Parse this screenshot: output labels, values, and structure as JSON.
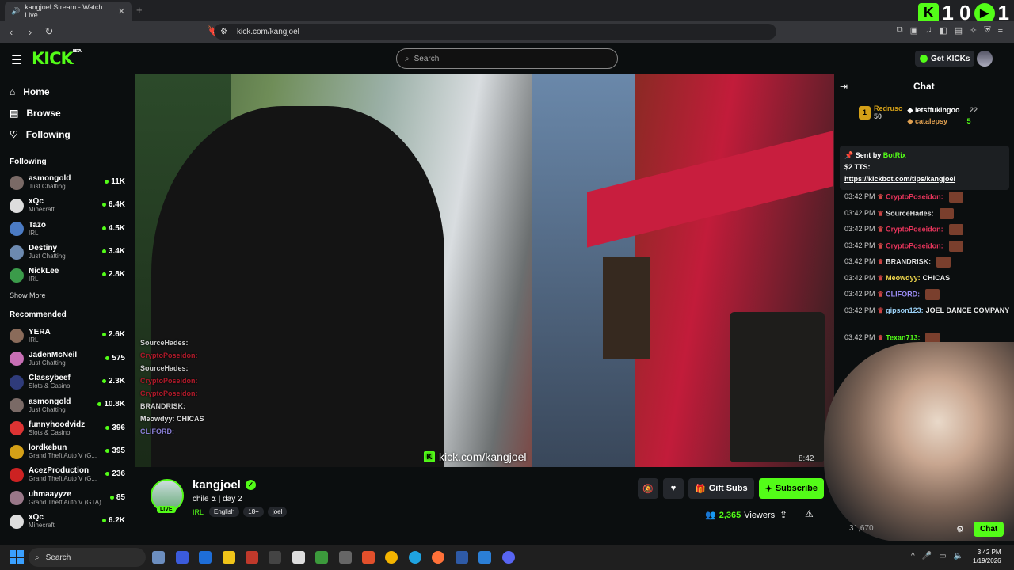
{
  "browser": {
    "tab_title": "kangjoel Stream - Watch Live",
    "url": "kick.com/kangjoel",
    "overlay_counter_1": "1 0",
    "overlay_counter_2": "1"
  },
  "header": {
    "logo": "KICK",
    "logo_badge": "BETA",
    "search_placeholder": "Search",
    "get_kicks": "Get KICKs"
  },
  "sidebar": {
    "nav": [
      {
        "icon": "home-icon",
        "label": "Home"
      },
      {
        "icon": "browse-icon",
        "label": "Browse"
      },
      {
        "icon": "heart-icon",
        "label": "Following"
      }
    ],
    "following_title": "Following",
    "following": [
      {
        "name": "asmongold",
        "category": "Just Chatting",
        "viewers": "11K",
        "color": "#7a6a66"
      },
      {
        "name": "xQc",
        "category": "Minecraft",
        "viewers": "6.4K",
        "color": "#dddddd"
      },
      {
        "name": "Tazo",
        "category": "IRL",
        "viewers": "4.5K",
        "color": "#4b7bc4"
      },
      {
        "name": "Destiny",
        "category": "Just Chatting",
        "viewers": "3.4K",
        "color": "#6d8ab0"
      },
      {
        "name": "NickLee",
        "category": "IRL",
        "viewers": "2.8K",
        "color": "#3b9b4a"
      }
    ],
    "show_more": "Show More",
    "recommended_title": "Recommended",
    "recommended": [
      {
        "name": "YERA",
        "category": "IRL",
        "viewers": "2.6K",
        "color": "#8a6b5a"
      },
      {
        "name": "JadenMcNeil",
        "category": "Just Chatting",
        "viewers": "575",
        "color": "#c86fb5"
      },
      {
        "name": "Classybeef",
        "category": "Slots & Casino",
        "viewers": "2.3K",
        "color": "#2f3b7a"
      },
      {
        "name": "asmongold",
        "category": "Just Chatting",
        "viewers": "10.8K",
        "color": "#7a6a66"
      },
      {
        "name": "funnyhoodvidz",
        "category": "Slots & Casino",
        "viewers": "396",
        "color": "#dd3333"
      },
      {
        "name": "lordkebun",
        "category": "Grand Theft Auto V (G...",
        "viewers": "395",
        "color": "#d4a017"
      },
      {
        "name": "AcezProduction",
        "category": "Grand Theft Auto V (G...",
        "viewers": "236",
        "color": "#cc2222"
      },
      {
        "name": "uhmaayyze",
        "category": "Grand Theft Auto V (GTA)",
        "viewers": "85",
        "color": "#997788"
      },
      {
        "name": "xQc",
        "category": "Minecraft",
        "viewers": "6.2K",
        "color": "#dddddd"
      }
    ]
  },
  "video": {
    "watermark": "kick.com/kangjoel",
    "time": "8:42",
    "overlay_chat": [
      {
        "user": "SourceHades:",
        "color": "#cccccc"
      },
      {
        "user": "CryptoPoseidon:",
        "color": "#b01a2a"
      },
      {
        "user": "SourceHades:",
        "color": "#cccccc"
      },
      {
        "user": "CryptoPoseidon:",
        "color": "#b01a2a"
      },
      {
        "user": "CryptoPoseidon:",
        "color": "#b01a2a"
      },
      {
        "user": "BRANDRISK:",
        "color": "#cccccc"
      },
      {
        "user": "Meowdyy: CHICAS",
        "color": "#dddddd"
      },
      {
        "user": "CLIFORD:",
        "color": "#8a7fd6"
      }
    ]
  },
  "stream": {
    "streamer": "kangjoel",
    "live": "LIVE",
    "title": "chile ⍺ | day 2",
    "category": "IRL",
    "tags": [
      "English",
      "18+",
      "joel"
    ],
    "viewers": "2,365",
    "viewers_label": "Viewers",
    "gift_subs": "Gift Subs",
    "subscribe": "Subscribe"
  },
  "chat": {
    "title": "Chat",
    "leaderboard": [
      {
        "rank": "1",
        "name": "Redruso",
        "value": "50"
      },
      {
        "name": "letsffukingoo",
        "value": "22"
      },
      {
        "name": "catalepsy",
        "value": "5"
      }
    ],
    "pinned": {
      "sent_by": "Sent by",
      "sender": "BotRix",
      "text": "$2 TTS:",
      "link": "https://kickbot.com/tips/kangjoel"
    },
    "messages": [
      {
        "time": "03:42 PM",
        "user": "CryptoPoseidon:",
        "text": "",
        "color": "#e5345b"
      },
      {
        "time": "03:42 PM",
        "user": "SourceHades:",
        "text": "",
        "color": "#dddddd"
      },
      {
        "time": "03:42 PM",
        "user": "CryptoPoseidon:",
        "text": "",
        "color": "#e5345b"
      },
      {
        "time": "03:42 PM",
        "user": "CryptoPoseidon:",
        "text": "",
        "color": "#e5345b"
      },
      {
        "time": "03:42 PM",
        "user": "BRANDRISK:",
        "text": "",
        "color": "#dddddd"
      },
      {
        "time": "03:42 PM",
        "user": "Meowdyy:",
        "text": "CHICAS",
        "color": "#f2d94e"
      },
      {
        "time": "03:42 PM",
        "user": "CLIFORD:",
        "text": "",
        "color": "#9b8cf5"
      },
      {
        "time": "03:42 PM",
        "user": "gipson123:",
        "text": "JOEL DANCE COMPANY",
        "color": "#9ad0f5"
      },
      {
        "time": "03:42 PM",
        "user": "Texan713:",
        "text": "",
        "color": "#53fc18"
      }
    ],
    "count_partial": "31,670",
    "chat_button": "Chat"
  },
  "taskbar": {
    "search": "Search",
    "time": "3:42 PM",
    "date": "1/19/2026"
  }
}
